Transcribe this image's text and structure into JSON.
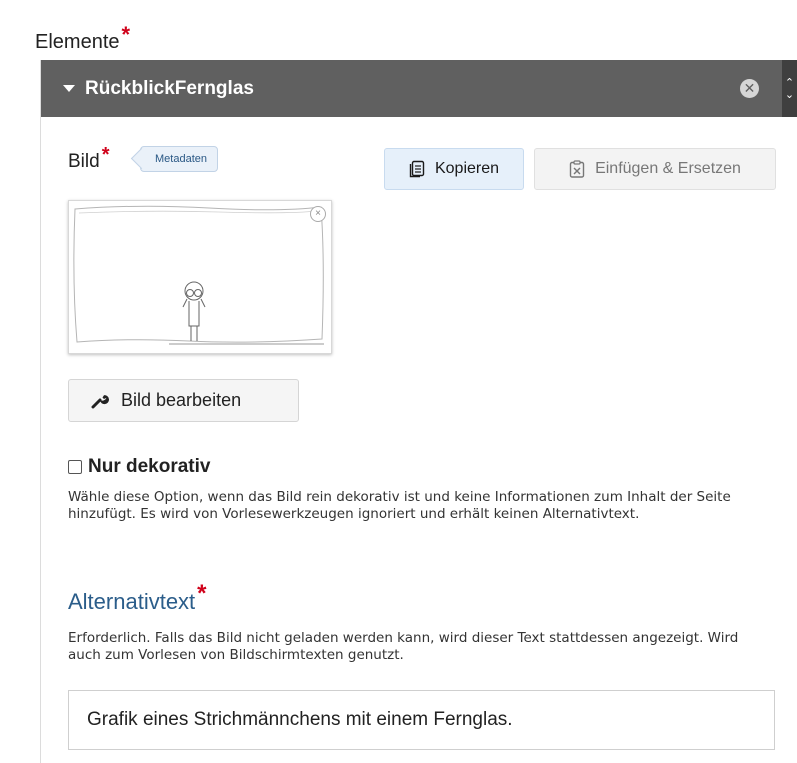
{
  "section": {
    "label": "Elemente",
    "required_mark": "*"
  },
  "group": {
    "title": "RückblickFernglas",
    "remove_symbol": "✕",
    "order_up": "⌃",
    "order_down": "⌄"
  },
  "image_field": {
    "label": "Bild",
    "required_mark": "*",
    "metadata_label": "Metadaten",
    "copy_label": "Kopieren",
    "paste_replace_label": "Einfügen & Ersetzen",
    "edit_label": "Bild bearbeiten",
    "thumbnail_remove": "×"
  },
  "decorative": {
    "checked": false,
    "label": "Nur dekorativ",
    "description": "Wähle diese Option, wenn das Bild rein dekorativ ist und keine Informationen zum Inhalt der Seite hinzufügt. Es wird von Vorlesewerkzeugen ignoriert und erhält keinen Alternativtext."
  },
  "alt_text": {
    "heading": "Alternativtext",
    "required_mark": "*",
    "description": "Erforderlich. Falls das Bild nicht geladen werden kann, wird dieser Text stattdessen angezeigt. Wird auch zum Vorlesen von Bildschirmtexten genutzt.",
    "value": "Grafik eines Strichmännchens mit einem Fernglas."
  },
  "colors": {
    "header_bg": "#606060",
    "required": "#d0021b",
    "heading_blue": "#2b5d8a",
    "copy_button_bg": "#e6f0fa"
  }
}
